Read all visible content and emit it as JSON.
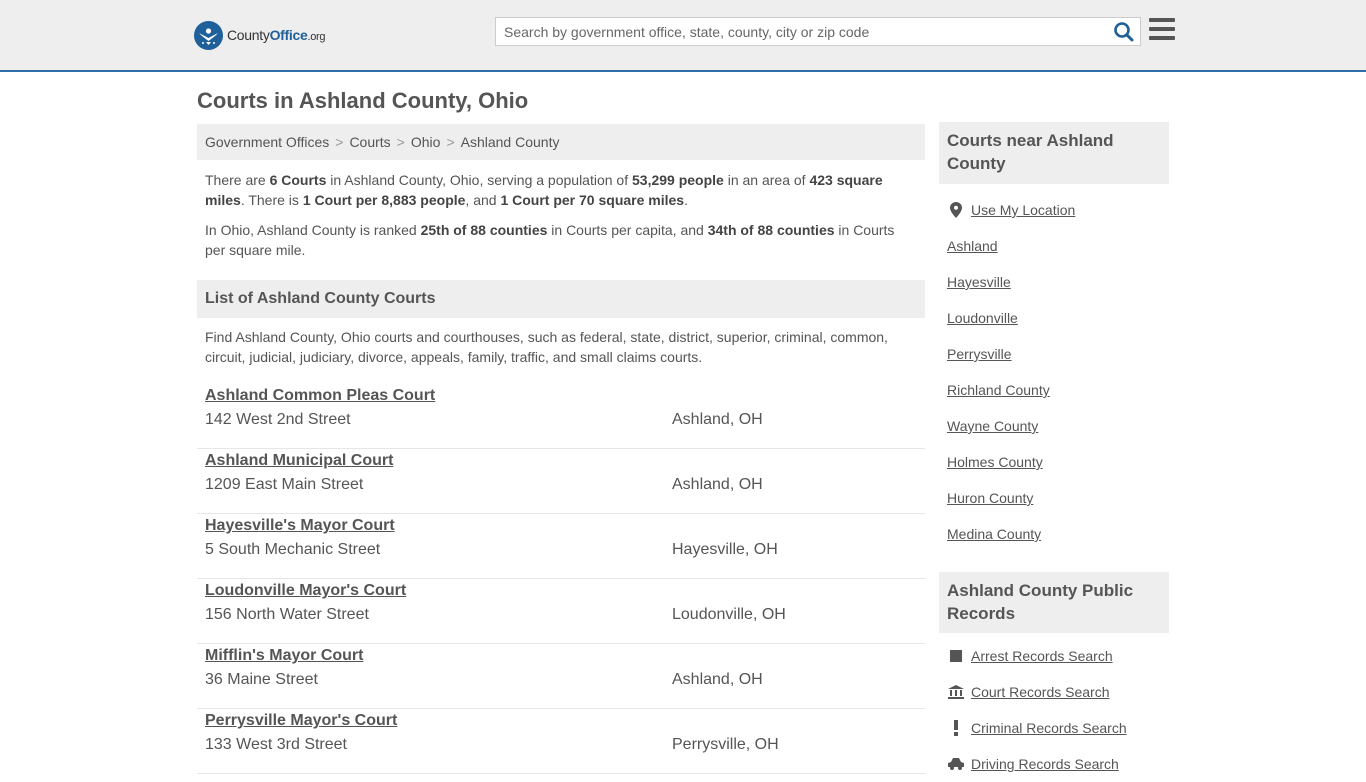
{
  "header": {
    "logo_main": "County",
    "logo_bold": "Office",
    "logo_suffix": ".org",
    "search_placeholder": "Search by government office, state, county, city or zip code"
  },
  "page": {
    "title": "Courts in Ashland County, Ohio"
  },
  "breadcrumb": [
    "Government Offices",
    "Courts",
    "Ohio",
    "Ashland County"
  ],
  "summary": {
    "p1": [
      "There are ",
      "6 Courts",
      " in Ashland County, Ohio, serving a population of ",
      "53,299 people",
      " in an area of ",
      "423 square miles",
      ". There is ",
      "1 Court per 8,883 people",
      ", and ",
      "1 Court per 70 square miles",
      "."
    ],
    "p2": [
      "In Ohio, Ashland County is ranked ",
      "25th of 88 counties",
      " in Courts per capita, and ",
      "34th of 88 counties",
      " in Courts per square mile."
    ]
  },
  "list": {
    "heading": "List of Ashland County Courts",
    "description": "Find Ashland County, Ohio courts and courthouses, such as federal, state, district, superior, criminal, common, circuit, judicial, judiciary, divorce, appeals, family, traffic, and small claims courts.",
    "courts": [
      {
        "name": "Ashland Common Pleas Court",
        "address": "142 West 2nd Street",
        "city": "Ashland, OH"
      },
      {
        "name": "Ashland Municipal Court",
        "address": "1209 East Main Street",
        "city": "Ashland, OH"
      },
      {
        "name": "Hayesville's Mayor Court",
        "address": "5 South Mechanic Street",
        "city": "Hayesville, OH"
      },
      {
        "name": "Loudonville Mayor's Court",
        "address": "156 North Water Street",
        "city": "Loudonville, OH"
      },
      {
        "name": "Mifflin's Mayor Court",
        "address": "36 Maine Street",
        "city": "Ashland, OH"
      },
      {
        "name": "Perrysville Mayor's Court",
        "address": "133 West 3rd Street",
        "city": "Perrysville, OH"
      }
    ]
  },
  "sidebar": {
    "nearby_heading": "Courts near Ashland County",
    "use_location": "Use My Location",
    "nearby": [
      "Ashland",
      "Hayesville",
      "Loudonville",
      "Perrysville",
      "Richland County",
      "Wayne County",
      "Holmes County",
      "Huron County",
      "Medina County"
    ],
    "records_heading": "Ashland County Public Records",
    "records": [
      {
        "label": "Arrest Records Search",
        "icon": "square-icon"
      },
      {
        "label": "Court Records Search",
        "icon": "courthouse-icon"
      },
      {
        "label": "Criminal Records Search",
        "icon": "exclamation-icon"
      },
      {
        "label": "Driving Records Search",
        "icon": "car-icon"
      }
    ]
  },
  "colors": {
    "brand": "#1f5f9a",
    "header_bg": "#eeeeee",
    "header_border": "#2f6fa8",
    "text": "#555555"
  }
}
